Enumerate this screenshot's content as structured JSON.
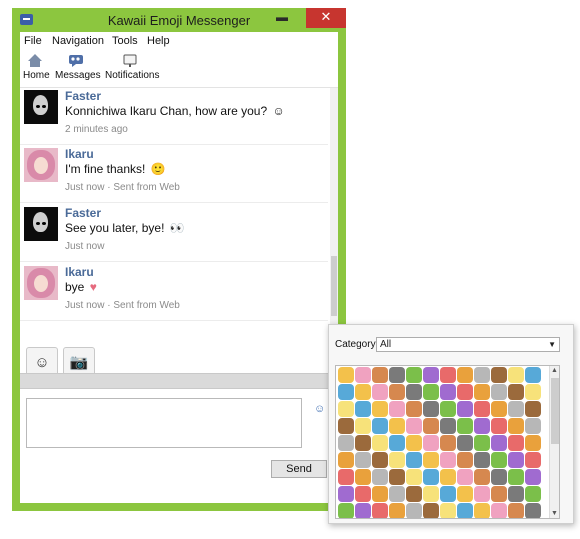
{
  "window": {
    "title": "Kawaii Emoji Messenger",
    "minimize_label": "▬",
    "close_label": "✕"
  },
  "menu": [
    "File",
    "Navigation",
    "Tools",
    "Help"
  ],
  "toolbar": [
    {
      "label": "Home",
      "icon": "home-icon"
    },
    {
      "label": "Messages",
      "icon": "messages-icon"
    },
    {
      "label": "Notifications",
      "icon": "notifications-icon"
    }
  ],
  "messages": [
    {
      "sender": "Faster",
      "text": "Konnichiwa Ikaru Chan, how are you?",
      "emoji": "☺",
      "meta": "2 minutes ago",
      "avatar": "faster"
    },
    {
      "sender": "Ikaru",
      "text": "I'm fine thanks!",
      "emoji": "🙂",
      "meta": "Just now · Sent from Web",
      "avatar": "ikaru"
    },
    {
      "sender": "Faster",
      "text": "See you later, bye!",
      "emoji": "👀",
      "meta": "Just now",
      "avatar": "faster"
    },
    {
      "sender": "Ikaru",
      "text": "bye",
      "emoji": "♥",
      "meta": "Just now · Sent from Web",
      "avatar": "ikaru"
    }
  ],
  "actions": {
    "emoji_button": "☺",
    "camera_button": "📷"
  },
  "compose": {
    "value": "",
    "placeholder": "",
    "emoji_toggle": "☺",
    "send_label": "Send"
  },
  "picker": {
    "category_label": "Category",
    "category_value": "All",
    "palette": [
      "#f3c14b",
      "#e9a13c",
      "#d6884f",
      "#9b6a3c",
      "#7bbf4a",
      "#57a9d8",
      "#e86a6a",
      "#f0a2c0",
      "#b7b7b7",
      "#7a7a7a",
      "#f7e27a",
      "#a06bd0"
    ]
  },
  "colors": {
    "frame": "#8cc63f",
    "close": "#c7352f",
    "sender": "#4a6a98"
  }
}
